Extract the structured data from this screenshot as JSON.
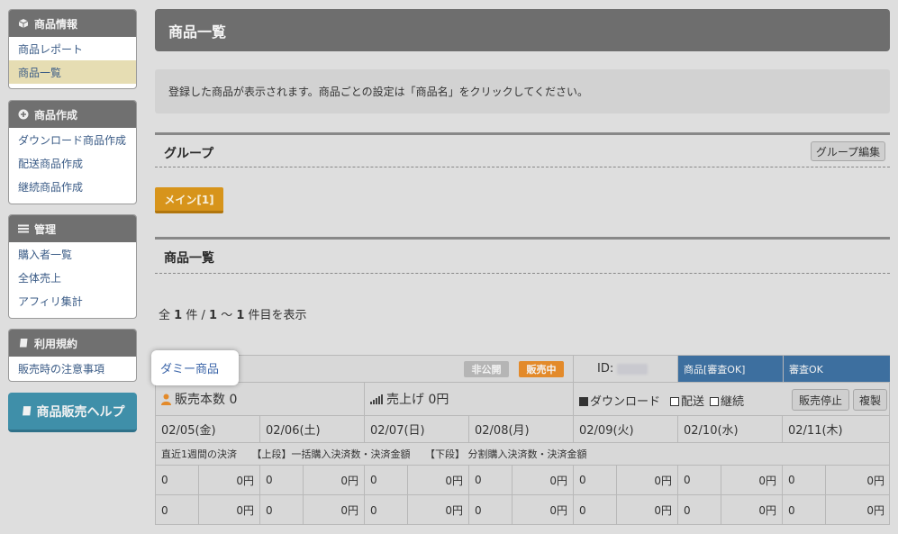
{
  "sidebar": {
    "sections": [
      {
        "title": "商品情報",
        "icon": "cube-icon",
        "items": [
          {
            "label": "商品レポート"
          },
          {
            "label": "商品一覧"
          }
        ]
      },
      {
        "title": "商品作成",
        "icon": "plus-circle-icon",
        "items": [
          {
            "label": "ダウンロード商品作成"
          },
          {
            "label": "配送商品作成"
          },
          {
            "label": "継続商品作成"
          }
        ]
      },
      {
        "title": "管理",
        "icon": "list-icon",
        "items": [
          {
            "label": "購入者一覧"
          },
          {
            "label": "全体売上"
          },
          {
            "label": "アフィリ集計"
          }
        ]
      },
      {
        "title": "利用規約",
        "icon": "book-icon",
        "items": [
          {
            "label": "販売時の注意事項"
          }
        ]
      }
    ],
    "help_button": "商品販売ヘルプ"
  },
  "main": {
    "title": "商品一覧",
    "info": "登録した商品が表示されます。商品ごとの設定は「商品名」をクリックしてください。",
    "group_section": {
      "title": "グループ",
      "edit_button": "グループ編集",
      "tag": "メイン[1]"
    },
    "list_section": {
      "title": "商品一覧"
    },
    "count": {
      "prefix": "全",
      "total": "1",
      "mid": "件 /",
      "from": "1",
      "tilde": "～",
      "to": "1",
      "suffix": "件目を表示"
    }
  },
  "product": {
    "name": "ダミー商品",
    "badge_private": "非公開",
    "badge_selling": "販売中",
    "id_label": "ID:",
    "review_status_label": "商品[審査OK]",
    "review_status": "審査OK",
    "sales_count_label": "販売本数 0",
    "revenue_label": "売上げ 0円",
    "types": [
      {
        "label": "ダウンロード",
        "checked": true
      },
      {
        "label": "配送",
        "checked": false
      },
      {
        "label": "継続",
        "checked": false
      }
    ],
    "stop_button": "販売停止",
    "copy_button": "複製",
    "dates": [
      "02/05(金)",
      "02/06(土)",
      "02/07(日)",
      "02/08(月)",
      "02/09(火)",
      "02/10(水)",
      "02/11(木)"
    ],
    "note": "直近1週間の決済　　【上段】一括購入決済数・決済金額　　【下段】 分割購入決済数・決済金額",
    "rows": [
      [
        {
          "count": "0",
          "amount": "0円"
        },
        {
          "count": "0",
          "amount": "0円"
        },
        {
          "count": "0",
          "amount": "0円"
        },
        {
          "count": "0",
          "amount": "0円"
        },
        {
          "count": "0",
          "amount": "0円"
        },
        {
          "count": "0",
          "amount": "0円"
        },
        {
          "count": "0",
          "amount": "0円"
        }
      ],
      [
        {
          "count": "0",
          "amount": "0円"
        },
        {
          "count": "0",
          "amount": "0円"
        },
        {
          "count": "0",
          "amount": "0円"
        },
        {
          "count": "0",
          "amount": "0円"
        },
        {
          "count": "0",
          "amount": "0円"
        },
        {
          "count": "0",
          "amount": "0円"
        },
        {
          "count": "0",
          "amount": "0円"
        }
      ]
    ]
  },
  "colors": {
    "sidebar_header": "#707070",
    "help_button": "#3f8fa9",
    "group_tag": "#d7941b",
    "badge_selling": "#e38a2a",
    "status_blue": "#3d6f9f"
  }
}
